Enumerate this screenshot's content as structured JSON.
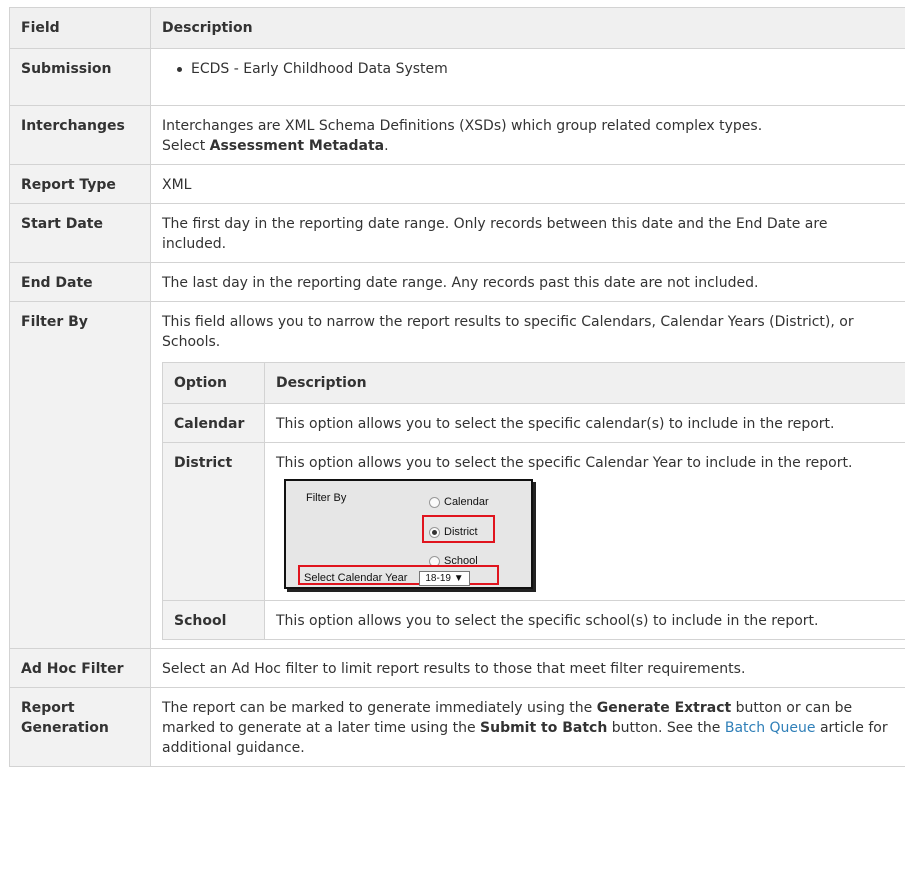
{
  "headers": {
    "field": "Field",
    "description": "Description"
  },
  "rows": {
    "submission": {
      "field": "Submission",
      "item": "ECDS - Early Childhood Data System"
    },
    "interchanges": {
      "field": "Interchanges",
      "text": "Interchanges are XML Schema Definitions (XSDs) which group related complex types.",
      "select_prefix": "Select ",
      "select_bold": "Assessment Metadata",
      "select_suffix": "."
    },
    "report_type": {
      "field": "Report Type",
      "text": "XML"
    },
    "start_date": {
      "field": "Start Date",
      "text": "The first day in the reporting date range. Only records between this date and the End Date are included."
    },
    "end_date": {
      "field": "End Date",
      "text": "The last day in the reporting date range. Any records past this date are not included."
    },
    "filter_by": {
      "field": "Filter By",
      "text": "This field allows you to narrow the report results to specific Calendars, Calendar Years (District), or Schools.",
      "option_header": "Option",
      "description_header": "Description",
      "options": [
        {
          "name": "Calendar",
          "text": "This option allows you to select the specific calendar(s) to include in the report."
        },
        {
          "name": "District",
          "text": "This option allows you to select the specific Calendar Year to include in the report."
        },
        {
          "name": "School",
          "text": "This option allows you to select the specific school(s) to include in the report."
        }
      ],
      "screenshot": {
        "label": "Filter By",
        "radio_calendar": "Calendar",
        "radio_district": "District",
        "radio_school": "School",
        "year_label": "Select Calendar Year",
        "year_value": "18-19",
        "selected": "District"
      }
    },
    "ad_hoc": {
      "field": "Ad Hoc Filter",
      "text": "Select an Ad Hoc filter to limit report results to those that meet filter requirements."
    },
    "report_generation": {
      "field": "Report Generation",
      "t1": "The report can be marked to generate immediately using the ",
      "b1": "Generate Extract",
      "t2": " button or can be marked to generate at a later time using the ",
      "b2": "Submit to Batch",
      "t3": " button. See the ",
      "link": "Batch Queue",
      "t4": " article for additional guidance."
    }
  },
  "colors": {
    "link": "#2f7fb8",
    "header_bg": "#f0f0f0",
    "highlight": "#e0141e"
  }
}
